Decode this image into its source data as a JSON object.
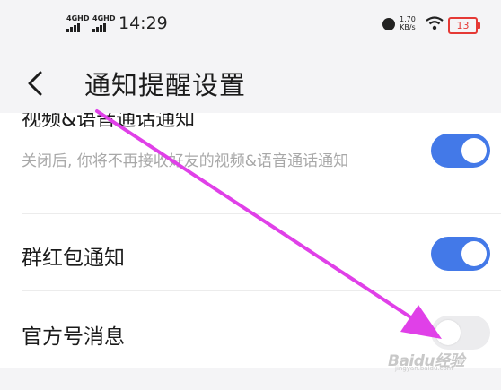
{
  "status_bar": {
    "signal1_label": "4GHD",
    "signal2_label": "4GHD",
    "time": "14:29",
    "speed_value": "1.70",
    "speed_unit": "KB/s",
    "battery_level": "13",
    "battery_color": "#e53935"
  },
  "header": {
    "back_icon": "chevron-left-icon",
    "title": "通知提醒设置"
  },
  "settings": {
    "video_voice": {
      "label": "视频&语音通话通知",
      "description": "关闭后, 你将不再接收好友的视频&语音通话通知",
      "enabled": true
    },
    "group_red_packet": {
      "label": "群红包通知",
      "enabled": true
    },
    "official_account": {
      "label": "官方号消息",
      "enabled": false
    }
  },
  "watermark": {
    "text": "Baidu经验",
    "sub": "jingyan.baidu.com"
  },
  "colors": {
    "accent": "#4379e8",
    "toggle_off": "#ececee",
    "annotation_arrow": "#e040e8"
  }
}
